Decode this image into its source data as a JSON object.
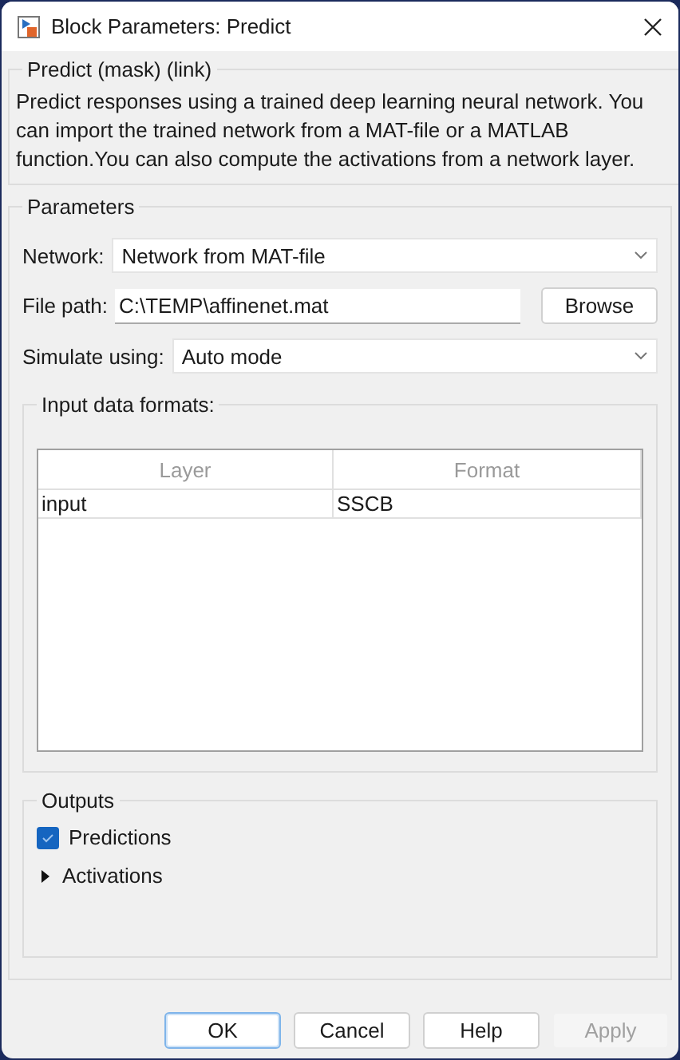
{
  "window": {
    "title": "Block Parameters: Predict"
  },
  "description": {
    "title": "Predict (mask) (link)",
    "text": "Predict responses using a trained deep learning neural network. You can import the trained network from a MAT-file or a MATLAB function.You can also compute the activations from a network layer."
  },
  "parameters": {
    "title": "Parameters",
    "network": {
      "label": "Network:",
      "value": "Network from MAT-file"
    },
    "file_path": {
      "label": "File path:",
      "value": "C:\\TEMP\\affinenet.mat",
      "button": "Browse"
    },
    "simulate": {
      "label": "Simulate using:",
      "value": "Auto mode"
    },
    "input_formats": {
      "title": "Input data formats:",
      "columns": [
        "Layer",
        "Format"
      ],
      "rows": [
        [
          "input",
          "SSCB"
        ]
      ]
    }
  },
  "outputs": {
    "title": "Outputs",
    "items": [
      {
        "kind": "checkbox",
        "label": "Predictions",
        "checked": true
      },
      {
        "kind": "expander",
        "label": "Activations",
        "expanded": false
      }
    ]
  },
  "buttons": [
    {
      "label": "OK",
      "focused": true,
      "disabled": false
    },
    {
      "label": "Cancel",
      "focused": false,
      "disabled": false
    },
    {
      "label": "Help",
      "focused": false,
      "disabled": false
    },
    {
      "label": "Apply",
      "focused": false,
      "disabled": true
    }
  ]
}
